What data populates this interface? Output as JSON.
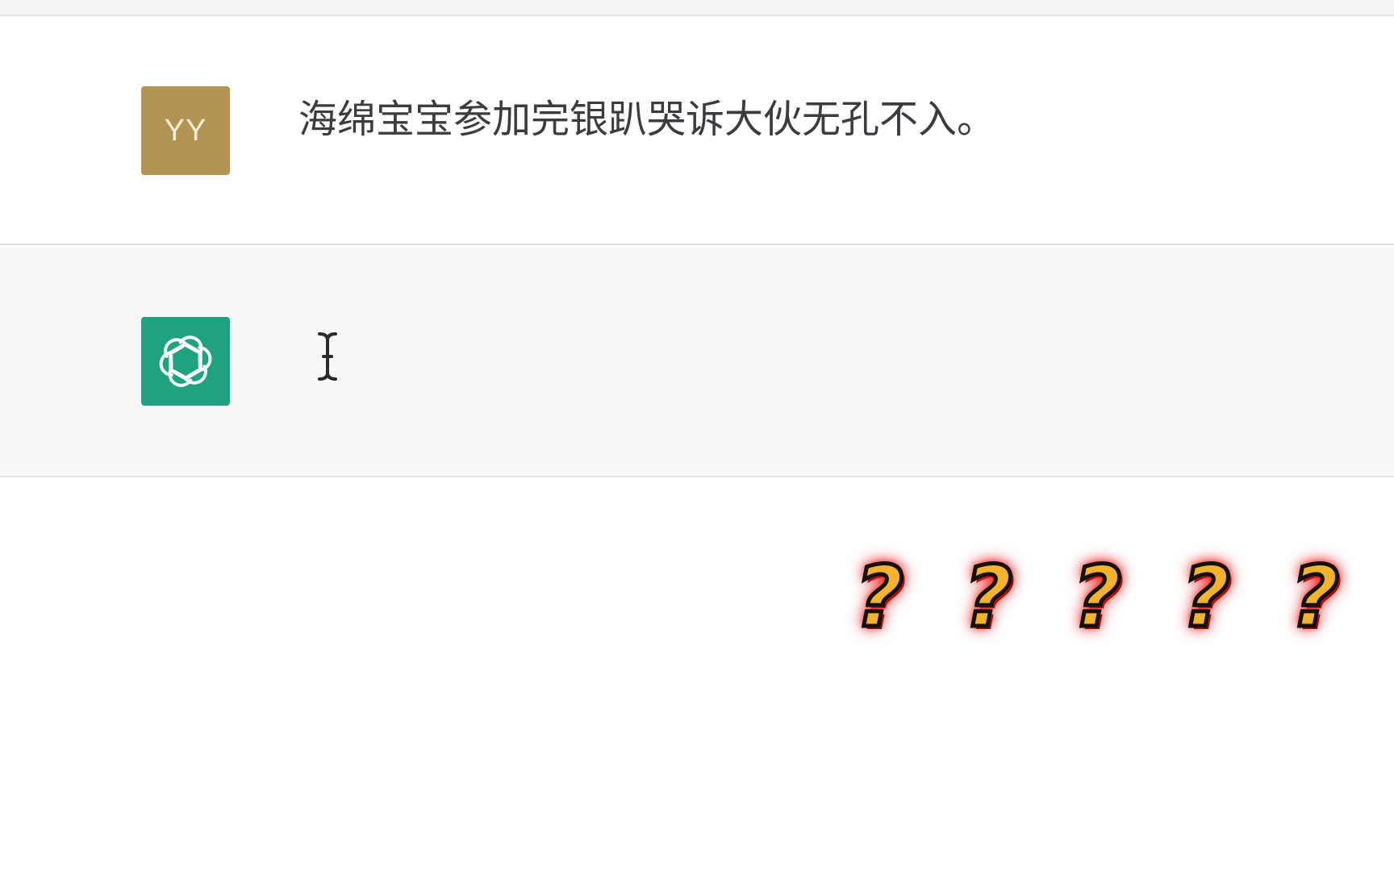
{
  "conversation": {
    "user_message": {
      "avatar_initials": "YY",
      "avatar_color": "#b39352",
      "text": "海绵宝宝参加完银趴哭诉大伙无孔不入。"
    },
    "assistant_message": {
      "avatar_icon": "openai-logo-icon",
      "avatar_color": "#1fa37f",
      "text": "",
      "cursor_icon": "text-cursor-icon"
    }
  },
  "overlay": {
    "reaction_marks": [
      "?",
      "?",
      "?",
      "?",
      "?"
    ],
    "mark_color": "#f4b32a",
    "glow_color": "#ff1d1d"
  }
}
